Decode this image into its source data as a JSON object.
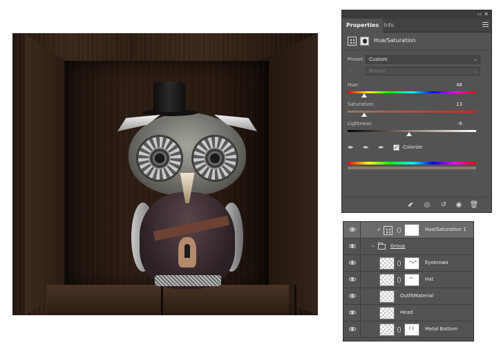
{
  "properties_panel": {
    "tabs": [
      {
        "label": "Properties"
      },
      {
        "label": "Info"
      }
    ],
    "adjustment_title": "Hue/Saturation",
    "preset": {
      "label": "Preset:",
      "value": "Custom"
    },
    "channel": {
      "value": "Master"
    },
    "hue": {
      "label": "Hue:",
      "value": "48",
      "position_fraction": 0.13
    },
    "saturation": {
      "label": "Saturation:",
      "value": "13",
      "position_fraction": 0.13
    },
    "lightness": {
      "label": "Lightness:",
      "value": "-6",
      "position_fraction": 0.48
    },
    "colorize": {
      "label": "Colorize",
      "checked": true,
      "check_glyph": "✓"
    },
    "icons": {
      "eyedropper": "✒",
      "hand": "☝",
      "clip": "⬋",
      "view_previous": "◎",
      "reset": "↺",
      "visibility": "◉",
      "delete": "🗑"
    }
  },
  "layers_panel": {
    "rows": [
      {
        "name": "Hue/Saturation 1",
        "type": "adjustment",
        "selected": true
      },
      {
        "name": "Group",
        "type": "group"
      },
      {
        "name": "Eyebrows",
        "type": "layer",
        "mask_mark": "ᴖᴗᴖ"
      },
      {
        "name": "Hat",
        "type": "layer",
        "mask_mark": "⌒"
      },
      {
        "name": "OutfitMaterial",
        "type": "layer"
      },
      {
        "name": "Head",
        "type": "layer"
      },
      {
        "name": "Metal Bottom",
        "type": "layer",
        "mask_mark": "( )"
      }
    ]
  },
  "colors": {
    "panel_bg": "#535353",
    "panel_dark": "#424242",
    "selected_row": "#6b6b6b",
    "text": "#e9e9e9"
  }
}
